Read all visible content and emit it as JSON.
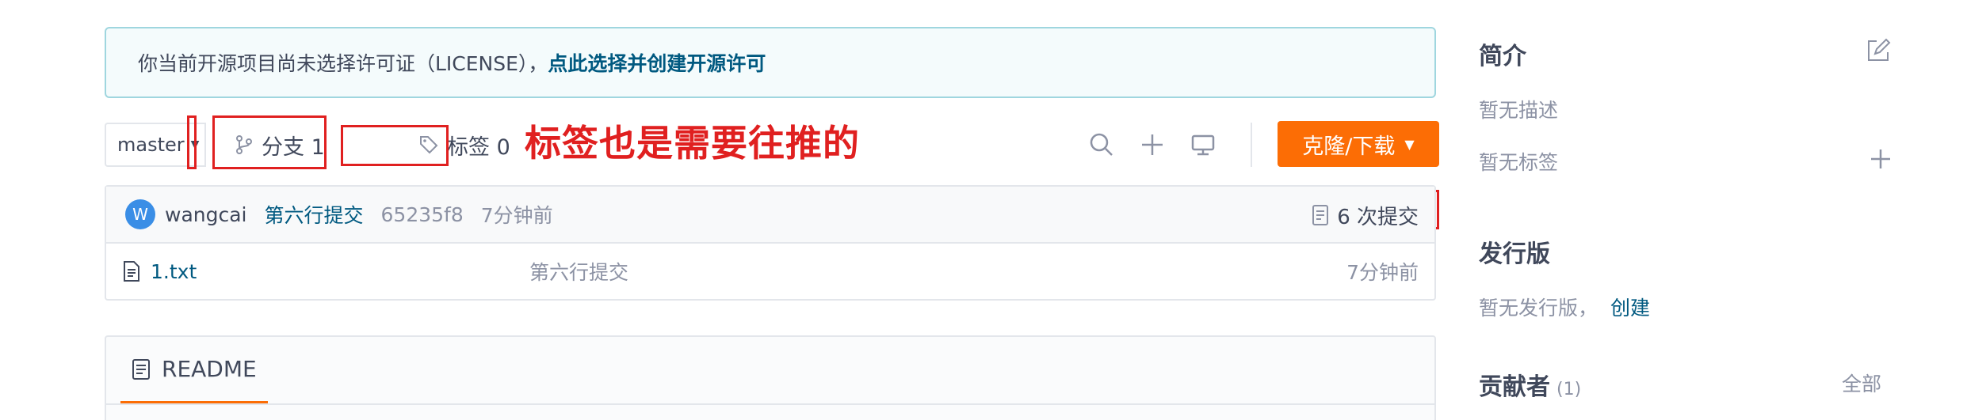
{
  "license": {
    "notice": "你当前开源项目尚未选择许可证（LICENSE），",
    "link": "点此选择并创建开源许可"
  },
  "toolbar": {
    "branch": "master",
    "branches_label": "分支 1",
    "tags_label": "标签 0",
    "annotation": "标签也是需要往推的",
    "clone_label": "克隆/下载"
  },
  "commit": {
    "avatar_letter": "W",
    "author": "wangcai",
    "message": "第六行提交",
    "sha": "65235f8",
    "time": "7分钟前",
    "count_label": "6 次提交"
  },
  "files": [
    {
      "name": "1.txt",
      "message": "第六行提交",
      "time": "7分钟前"
    }
  ],
  "readme": {
    "tab": "README"
  },
  "sidebar": {
    "intro_title": "简介",
    "intro_desc": "暂无描述",
    "intro_tags": "暂无标签",
    "releases_title": "发行版",
    "releases_text": "暂无发行版，",
    "releases_link": "创建",
    "contributors_title": "贡献者",
    "contributors_count": "(1)",
    "contributors_all": "全部"
  },
  "colors": {
    "accent": "#fc6d05",
    "link": "#005980",
    "annotation": "#e02020"
  }
}
